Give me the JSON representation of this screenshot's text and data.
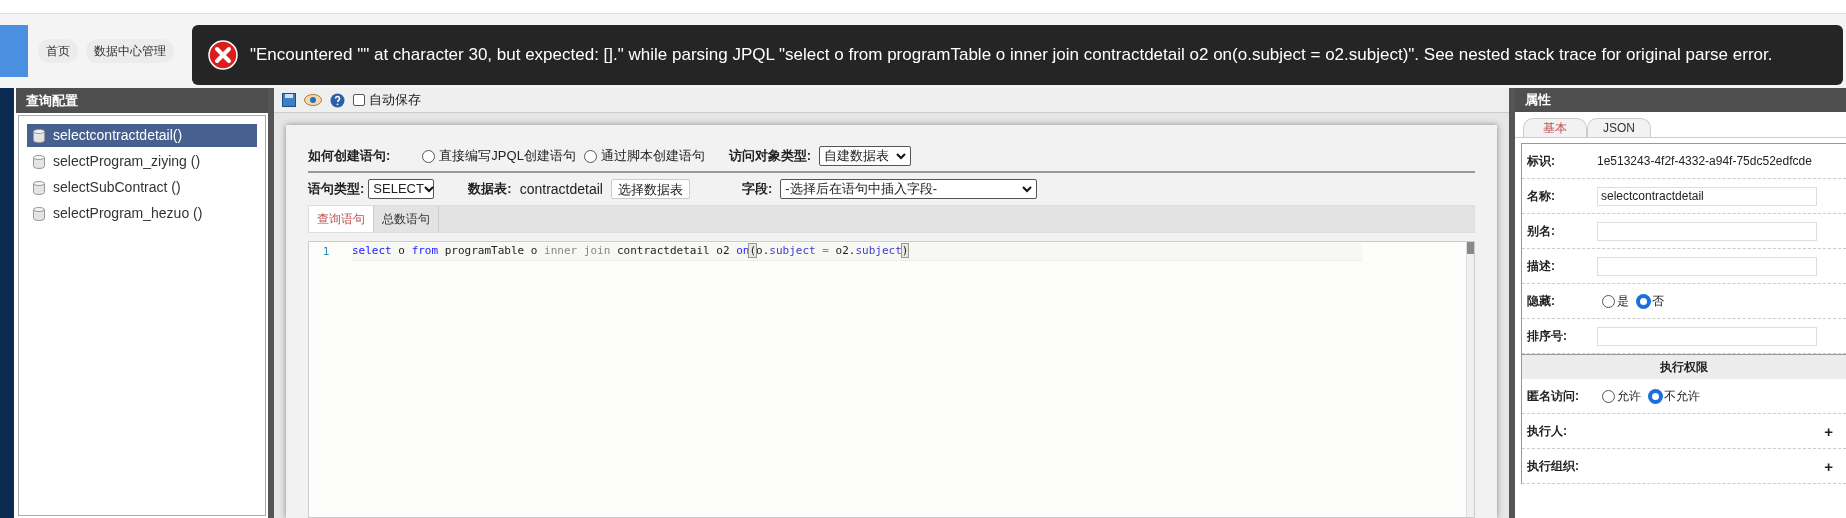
{
  "nav_tabs": [
    {
      "label": "首页"
    },
    {
      "label": "数据中心管理"
    }
  ],
  "error_toast": {
    "message": "\"Encountered \"\" at character 30, but expected: [].\" while parsing JPQL \"select o from programTable o inner join contractdetail o2 on(o.subject = o2.subject)\". See nested stack trace for original parse error."
  },
  "left_panel": {
    "title": "查询配置",
    "items": [
      {
        "label": "selectcontractdetail()",
        "selected": true
      },
      {
        "label": "selectProgram_ziying ()",
        "selected": false
      },
      {
        "label": "selectSubContract ()",
        "selected": false
      },
      {
        "label": "selectProgram_hezuo ()",
        "selected": false
      }
    ]
  },
  "toolbar": {
    "auto_save": {
      "label": "自动保存",
      "checked": false
    }
  },
  "form": {
    "create_label": "如何创建语句:",
    "create_options": [
      {
        "label": "直接编写JPQL创建语句",
        "selected": false
      },
      {
        "label": "通过脚本创建语句",
        "selected": false
      }
    ],
    "object_type_label": "访问对象类型:",
    "object_type": "自建数据表",
    "statement_type_label": "语句类型:",
    "statement_type": "SELECT",
    "table_label": "数据表:",
    "table": "contractdetail",
    "choose_table_button": "选择数据表",
    "field_label": "字段:",
    "field_select": "-选择后在语句中插入字段-"
  },
  "editor_tabs": [
    {
      "label": "查询语句",
      "selected": true
    },
    {
      "label": "总数语句",
      "selected": false
    }
  ],
  "editor": {
    "lines": [
      {
        "number": "1",
        "tokens": [
          {
            "text": "select",
            "kind": "keyword"
          },
          {
            "text": " o ",
            "kind": "plain"
          },
          {
            "text": "from",
            "kind": "keyword"
          },
          {
            "text": " programTable o ",
            "kind": "plain"
          },
          {
            "text": "inner join",
            "kind": "muted"
          },
          {
            "text": " contractdetail o2 ",
            "kind": "plain"
          },
          {
            "text": "on",
            "kind": "keyword"
          },
          {
            "text": "(",
            "kind": "bracket"
          },
          {
            "text": "o.",
            "kind": "plain"
          },
          {
            "text": "subject",
            "kind": "property"
          },
          {
            "text": " = ",
            "kind": "muted"
          },
          {
            "text": "o2.",
            "kind": "plain"
          },
          {
            "text": "subject",
            "kind": "property"
          },
          {
            "text": ")",
            "kind": "bracket"
          }
        ]
      }
    ]
  },
  "right_panel": {
    "title": "属性",
    "tabs": [
      {
        "label": "基本",
        "selected": true
      },
      {
        "label": "JSON",
        "selected": false
      }
    ],
    "rows": [
      {
        "kind": "text",
        "label": "标识:",
        "value": "1e513243-4f2f-4332-a94f-75dc52edfcde"
      },
      {
        "kind": "input",
        "label": "名称:",
        "value": "selectcontractdetail"
      },
      {
        "kind": "input",
        "label": "别名:"
      },
      {
        "kind": "input",
        "label": "描述:"
      },
      {
        "kind": "radio",
        "label": "隐藏:",
        "options": [
          {
            "label": "是",
            "selected": false
          },
          {
            "label": "否",
            "selected": true
          }
        ]
      },
      {
        "kind": "input",
        "label": "排序号:"
      },
      {
        "kind": "section",
        "label": "执行权限"
      },
      {
        "kind": "radio",
        "label": "匿名访问:",
        "options": [
          {
            "label": "允许",
            "selected": false
          },
          {
            "label": "不允许",
            "selected": true
          }
        ]
      },
      {
        "kind": "add",
        "label": "执行人:",
        "button": "+"
      },
      {
        "kind": "add",
        "label": "执行组织:",
        "button": "+"
      }
    ]
  }
}
